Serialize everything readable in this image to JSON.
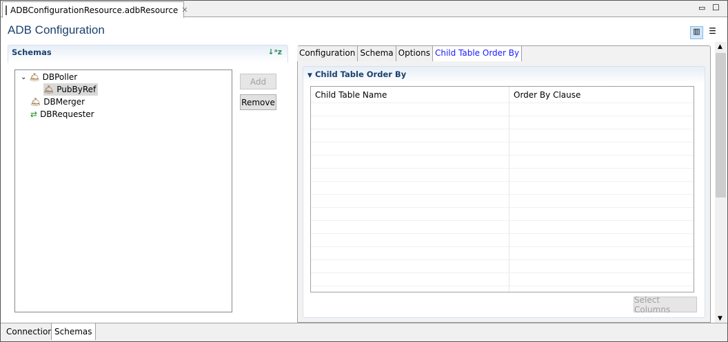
{
  "editor_tab": {
    "label": "ADBConfigurationResource.adbResource"
  },
  "page_title": "ADB Configuration",
  "schemas": {
    "title": "Schemas",
    "tree": [
      {
        "label": "DBPoller"
      },
      {
        "label": "PubByRef"
      },
      {
        "label": "DBMerger"
      },
      {
        "label": "DBRequester"
      }
    ],
    "add_label": "Add",
    "remove_label": "Remove"
  },
  "tabs": [
    {
      "label": "Configuration"
    },
    {
      "label": "Schema"
    },
    {
      "label": "Options"
    },
    {
      "label": "Child Table Order By"
    }
  ],
  "section": {
    "title": "Child Table Order By",
    "columns": [
      "Child Table Name",
      "Order By Clause"
    ],
    "select_columns_label": "Select Columns"
  },
  "bottom_tabs": [
    {
      "label": "Connection"
    },
    {
      "label": "Schemas"
    }
  ]
}
